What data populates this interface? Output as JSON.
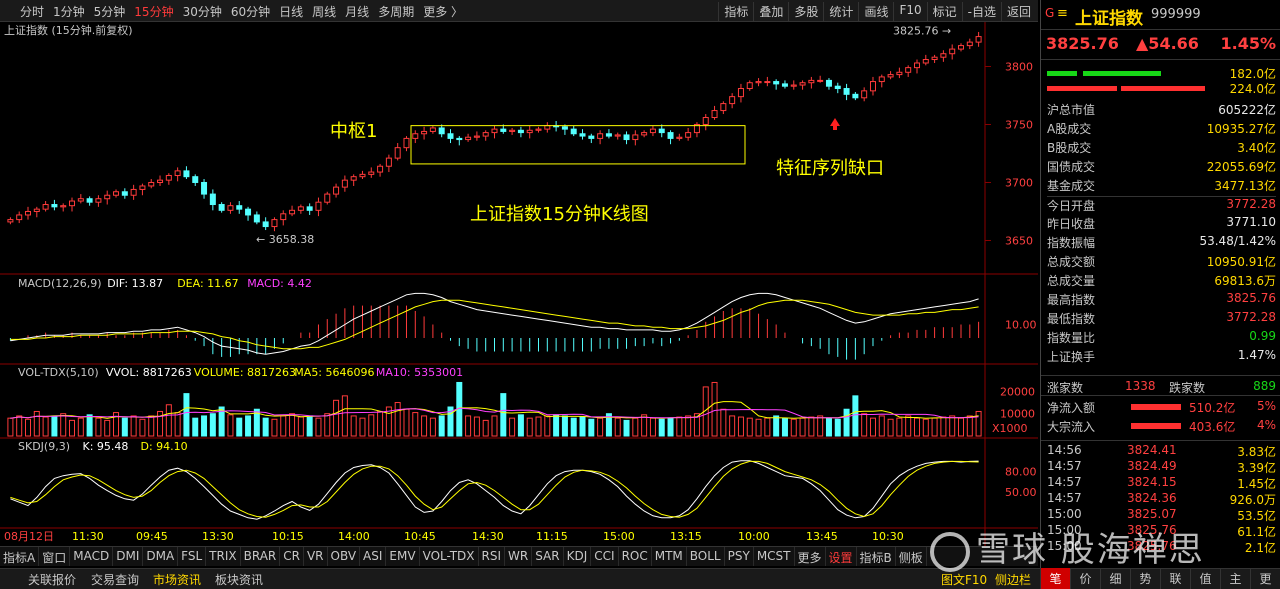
{
  "toolbar": {
    "periods": [
      "分时",
      "1分钟",
      "5分钟",
      "15分钟",
      "30分钟",
      "60分钟",
      "日线",
      "周线",
      "月线",
      "多周期",
      "更多 〉"
    ],
    "active_period": 3,
    "tools": [
      "指标",
      "叠加",
      "多股",
      "统计",
      "画线",
      "F10",
      "标记",
      "-自选",
      "返回"
    ]
  },
  "chart": {
    "title": "上证指数 (15分钟.前复权)",
    "annotation_center": "中枢1",
    "annotation_title": "上证指数15分钟K线图",
    "annotation_gap": "特征序列缺口",
    "high_label": "3825.76",
    "low_label": "3658.38",
    "price_ticks": [
      "3800",
      "3750",
      "3700",
      "3650"
    ],
    "macd_header": {
      "name": "MACD(12,26,9)",
      "dif": "DIF: 13.87",
      "dea": "DEA: 11.67",
      "macd": "MACD: 4.42"
    },
    "macd_tick": "10.00",
    "vol_header": {
      "name": "VOL-TDX(5,10)",
      "vvol": "VVOL: 8817263",
      "volume": "VOLUME: 8817263",
      "ma5": "MA5: 5646096",
      "ma10": "MA10: 5353001"
    },
    "vol_ticks": [
      "20000",
      "10000"
    ],
    "vol_unit": "X1000",
    "skdj_header": {
      "name": "SKDJ(9,3)",
      "k": "K: 95.48",
      "d": "D: 94.10"
    },
    "skdj_ticks": [
      "80.00",
      "50.00"
    ],
    "time_labels": [
      "08月12日",
      "11:30",
      "09:45",
      "13:30",
      "10:15",
      "14:00",
      "10:45",
      "14:30",
      "11:15",
      "15:00",
      "13:15",
      "10:00",
      "13:45",
      "10:30"
    ]
  },
  "chart_data": {
    "type": "candlestick",
    "title": "上证指数 (15分钟.前复权)",
    "close": [
      3668,
      3672,
      3675,
      3677,
      3681,
      3679,
      3680,
      3684,
      3686,
      3683,
      3686,
      3689,
      3692,
      3689,
      3694,
      3697,
      3700,
      3702,
      3706,
      3710,
      3705,
      3700,
      3690,
      3681,
      3676,
      3680,
      3677,
      3672,
      3666,
      3662,
      3668,
      3673,
      3676,
      3679,
      3676,
      3683,
      3690,
      3696,
      3702,
      3705,
      3707,
      3709,
      3714,
      3721,
      3730,
      3738,
      3742,
      3744,
      3747,
      3742,
      3738,
      3737,
      3739,
      3740,
      3743,
      3746,
      3744,
      3745,
      3743,
      3745,
      3746,
      3749,
      3748,
      3746,
      3742,
      3740,
      3738,
      3742,
      3740,
      3741,
      3737,
      3741,
      3743,
      3746,
      3743,
      3738,
      3739,
      3743,
      3750,
      3756,
      3762,
      3768,
      3774,
      3781,
      3786,
      3787,
      3787,
      3785,
      3783,
      3784,
      3786,
      3788,
      3788,
      3783,
      3781,
      3776,
      3773,
      3779,
      3787,
      3791,
      3793,
      3795,
      3799,
      3803,
      3806,
      3808,
      3811,
      3815,
      3818,
      3821,
      3825.76
    ],
    "price_range": [
      3628,
      3828
    ],
    "macd_dif": [
      -2,
      -1,
      0,
      1,
      2,
      2,
      2,
      3,
      3,
      3,
      3,
      4,
      4,
      4,
      5,
      5,
      6,
      6,
      7,
      8,
      6,
      4,
      1,
      -3,
      -6,
      -7,
      -8,
      -9,
      -11,
      -12,
      -11,
      -10,
      -8,
      -6,
      -5,
      -2,
      2,
      6,
      10,
      14,
      17,
      20,
      23,
      26,
      29,
      32,
      33,
      33,
      32,
      30,
      27,
      25,
      23,
      21,
      20,
      19,
      18,
      17,
      16,
      15,
      14,
      13,
      12,
      11,
      10,
      9,
      8,
      8,
      7,
      7,
      6,
      6,
      6,
      6,
      5,
      5,
      6,
      8,
      11,
      15,
      19,
      23,
      27,
      30,
      32,
      33,
      33,
      32,
      30,
      28,
      26,
      24,
      22,
      19,
      16,
      13,
      11,
      12,
      14,
      16,
      18,
      19,
      20,
      21,
      22,
      23,
      24,
      25,
      26,
      27,
      29
    ],
    "macd_dea": [
      -1,
      -1,
      -1,
      0,
      0,
      1,
      1,
      1,
      2,
      2,
      2,
      2,
      3,
      3,
      3,
      3,
      4,
      4,
      4,
      5,
      5,
      5,
      4,
      3,
      1,
      0,
      -2,
      -3,
      -5,
      -6,
      -7,
      -8,
      -8,
      -8,
      -7,
      -7,
      -5,
      -3,
      -1,
      2,
      5,
      8,
      11,
      14,
      17,
      20,
      23,
      25,
      27,
      28,
      28,
      28,
      27,
      26,
      25,
      24,
      23,
      22,
      21,
      20,
      19,
      18,
      17,
      16,
      15,
      14,
      13,
      12,
      11,
      11,
      10,
      9,
      9,
      8,
      8,
      7,
      7,
      7,
      8,
      9,
      11,
      13,
      16,
      19,
      21,
      24,
      26,
      27,
      28,
      28,
      28,
      27,
      26,
      25,
      23,
      21,
      19,
      18,
      17,
      17,
      17,
      17,
      18,
      18,
      19,
      19,
      20,
      21,
      21,
      22,
      23
    ],
    "volume_k": [
      8000,
      9000,
      7500,
      11000,
      8500,
      9000,
      10000,
      7000,
      8000,
      9500,
      8000,
      7000,
      10500,
      8000,
      9000,
      7500,
      9000,
      11000,
      14000,
      10500,
      19000,
      8000,
      9000,
      10000,
      13000,
      9500,
      8000,
      9000,
      12000,
      8000,
      7500,
      9000,
      10000,
      8500,
      9000,
      8000,
      10000,
      16000,
      18000,
      9000,
      8000,
      9500,
      11000,
      13000,
      15000,
      12000,
      10500,
      9000,
      8000,
      9000,
      13000,
      24000,
      9000,
      8500,
      7000,
      9000,
      19000,
      8000,
      9500,
      8000,
      8500,
      9000,
      9500,
      9000,
      8000,
      8500,
      7500,
      8000,
      10000,
      8000,
      7000,
      8000,
      9500,
      8000,
      7500,
      8000,
      8500,
      9000,
      10000,
      22000,
      24000,
      12000,
      9000,
      8500,
      8000,
      7500,
      8000,
      9000,
      8000,
      7500,
      8000,
      8500,
      9000,
      8000,
      7500,
      12000,
      18000,
      10000,
      8000,
      9000,
      7500,
      8000,
      9000,
      8000,
      7500,
      8000,
      8500,
      9000,
      8000,
      9000,
      11000
    ],
    "skdj_k": [
      40,
      35,
      30,
      42,
      58,
      70,
      74,
      76,
      77,
      70,
      60,
      52,
      45,
      40,
      38,
      47,
      60,
      72,
      82,
      85,
      80,
      70,
      58,
      45,
      32,
      22,
      17,
      12,
      10,
      15,
      22,
      30,
      36,
      28,
      23,
      32,
      48,
      64,
      78,
      86,
      89,
      90,
      86,
      78,
      62,
      45,
      28,
      20,
      22,
      36,
      52,
      64,
      68,
      62,
      52,
      42,
      30,
      22,
      18,
      30,
      46,
      62,
      74,
      80,
      82,
      82,
      80,
      76,
      68,
      58,
      44,
      32,
      22,
      15,
      12,
      12,
      15,
      24,
      40,
      58,
      74,
      86,
      94,
      96,
      96,
      92,
      86,
      80,
      74,
      72,
      70,
      62,
      52,
      38,
      24,
      16,
      12,
      14,
      26,
      44,
      62,
      74,
      82,
      88,
      92,
      94,
      95,
      95,
      94,
      95,
      95.48
    ],
    "skdj_d": [
      42,
      38,
      34,
      36,
      46,
      58,
      68,
      72,
      75,
      74,
      68,
      60,
      52,
      46,
      42,
      44,
      52,
      64,
      74,
      80,
      82,
      78,
      70,
      58,
      46,
      34,
      24,
      18,
      14,
      13,
      17,
      23,
      30,
      31,
      28,
      28,
      36,
      50,
      64,
      76,
      84,
      88,
      88,
      84,
      74,
      60,
      44,
      32,
      24,
      28,
      40,
      52,
      62,
      64,
      60,
      52,
      42,
      32,
      24,
      24,
      32,
      46,
      60,
      72,
      79,
      82,
      81,
      79,
      74,
      66,
      56,
      44,
      33,
      24,
      17,
      14,
      13,
      17,
      26,
      42,
      58,
      73,
      84,
      91,
      95,
      95,
      92,
      86,
      80,
      76,
      72,
      68,
      61,
      51,
      38,
      26,
      18,
      14,
      18,
      30,
      46,
      60,
      73,
      82,
      88,
      92,
      94,
      95,
      95,
      94.5,
      94.1
    ]
  },
  "panel": {
    "code_prefix": "G",
    "name": "上证指数",
    "code": "999999",
    "price": "3825.76",
    "change": "▲54.66",
    "change_pct": "1.45%",
    "bar_up": "182.0亿",
    "bar_down": "224.0亿",
    "rows": [
      {
        "k": "沪总市值",
        "v": "605222亿",
        "c": "white"
      },
      {
        "k": "A股成交",
        "v": "10935.27亿",
        "c": "yellow"
      },
      {
        "k": "B股成交",
        "v": "3.40亿",
        "c": "yellow"
      },
      {
        "k": "国债成交",
        "v": "22055.69亿",
        "c": "yellow"
      },
      {
        "k": "基金成交",
        "v": "3477.13亿",
        "c": "yellow"
      },
      {
        "k": "今日开盘",
        "v": "3772.28",
        "c": "red"
      },
      {
        "k": "昨日收盘",
        "v": "3771.10",
        "c": "white"
      },
      {
        "k": "指数振幅",
        "v": "53.48/1.42%",
        "c": "white"
      },
      {
        "k": "总成交额",
        "v": "10950.91亿",
        "c": "yellow"
      },
      {
        "k": "总成交量",
        "v": "69813.6万",
        "c": "yellow"
      },
      {
        "k": "最高指数",
        "v": "3825.76",
        "c": "red"
      },
      {
        "k": "最低指数",
        "v": "3772.28",
        "c": "red"
      },
      {
        "k": "指数量比",
        "v": "0.99",
        "c": "green"
      },
      {
        "k": "上证换手",
        "v": "1.47%",
        "c": "white"
      }
    ],
    "up_label": "涨家数",
    "up_count": "1338",
    "down_label": "跌家数",
    "down_count": "889",
    "flows": [
      {
        "k": "净流入额",
        "v": "510.2亿",
        "p": "5%"
      },
      {
        "k": "大宗流入",
        "v": "403.6亿",
        "p": "4%"
      }
    ],
    "ticks": [
      {
        "t": "14:56",
        "p": "3824.41",
        "a": "3.83亿"
      },
      {
        "t": "14:57",
        "p": "3824.49",
        "a": "3.39亿"
      },
      {
        "t": "14:57",
        "p": "3824.15",
        "a": "1.45亿"
      },
      {
        "t": "14:57",
        "p": "3824.36",
        "a": "926.0万"
      },
      {
        "t": "15:00",
        "p": "3825.07",
        "a": "53.5亿"
      },
      {
        "t": "15:00",
        "p": "3825.76",
        "a": "61.1亿"
      },
      {
        "t": "15:00",
        "p": "3825.76",
        "a": "2.1亿"
      }
    ],
    "tabs": [
      "笔",
      "价",
      "细",
      "势",
      "联",
      "值",
      "主",
      "更"
    ]
  },
  "indicators": [
    "指标A",
    "窗口",
    "MACD",
    "DMI",
    "DMA",
    "FSL",
    "TRIX",
    "BRAR",
    "CR",
    "VR",
    "OBV",
    "ASI",
    "EMV",
    "VOL-TDX",
    "RSI",
    "WR",
    "SAR",
    "KDJ",
    "CCI",
    "ROC",
    "MTM",
    "BOLL",
    "PSY",
    "MCST",
    "更多",
    "设置",
    "指标B",
    "侧板"
  ],
  "bottom": {
    "tabs": [
      "关联报价",
      "交易查询",
      "市场资讯",
      "板块资讯"
    ],
    "right": [
      "图文F10",
      "侧边栏"
    ]
  },
  "watermark": "雪球  股海禅思",
  "colors": {
    "up": "#ff3b3b",
    "down": "#54ffff",
    "dif": "#ffffff",
    "dea": "#ffff00",
    "annotation": "#ffff00"
  }
}
